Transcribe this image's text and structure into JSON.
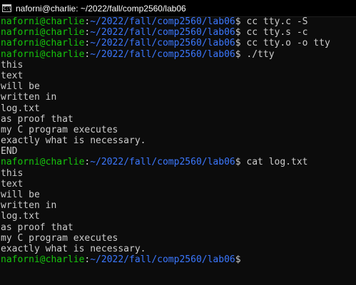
{
  "window": {
    "title": "naforni@charlie: ~/2022/fall/comp2560/lab06",
    "icon": "console-icon",
    "icon_glyph": "C:\\"
  },
  "colors": {
    "background": "#0c0c0c",
    "user_host": "#16c60c",
    "path": "#3b78ff",
    "text": "#cccccc"
  },
  "terminal": {
    "lines": [
      {
        "user": "naforni@charlie",
        "sep": ":",
        "path": "~/2022/fall/comp2560/lab06",
        "cmd": "$ cc tty.c -S"
      },
      {
        "user": "naforni@charlie",
        "sep": ":",
        "path": "~/2022/fall/comp2560/lab06",
        "cmd": "$ cc tty.s -c"
      },
      {
        "user": "naforni@charlie",
        "sep": ":",
        "path": "~/2022/fall/comp2560/lab06",
        "cmd": "$ cc tty.o -o tty"
      },
      {
        "user": "naforni@charlie",
        "sep": ":",
        "path": "~/2022/fall/comp2560/lab06",
        "cmd": "$ ./tty"
      },
      {
        "text": "this"
      },
      {
        "text": "text"
      },
      {
        "text": "will be"
      },
      {
        "text": "written in"
      },
      {
        "text": "log.txt"
      },
      {
        "text": "as proof that"
      },
      {
        "text": "my C program executes"
      },
      {
        "text": "exactly what is necessary."
      },
      {
        "text": "END"
      },
      {
        "user": "naforni@charlie",
        "sep": ":",
        "path": "~/2022/fall/comp2560/lab06",
        "cmd": "$ cat log.txt"
      },
      {
        "text": "this"
      },
      {
        "text": "text"
      },
      {
        "text": "will be"
      },
      {
        "text": "written in"
      },
      {
        "text": "log.txt"
      },
      {
        "text": "as proof that"
      },
      {
        "text": "my C program executes"
      },
      {
        "text": "exactly what is necessary."
      },
      {
        "user": "naforni@charlie",
        "sep": ":",
        "path": "~/2022/fall/comp2560/lab06",
        "cmd": "$"
      }
    ]
  }
}
